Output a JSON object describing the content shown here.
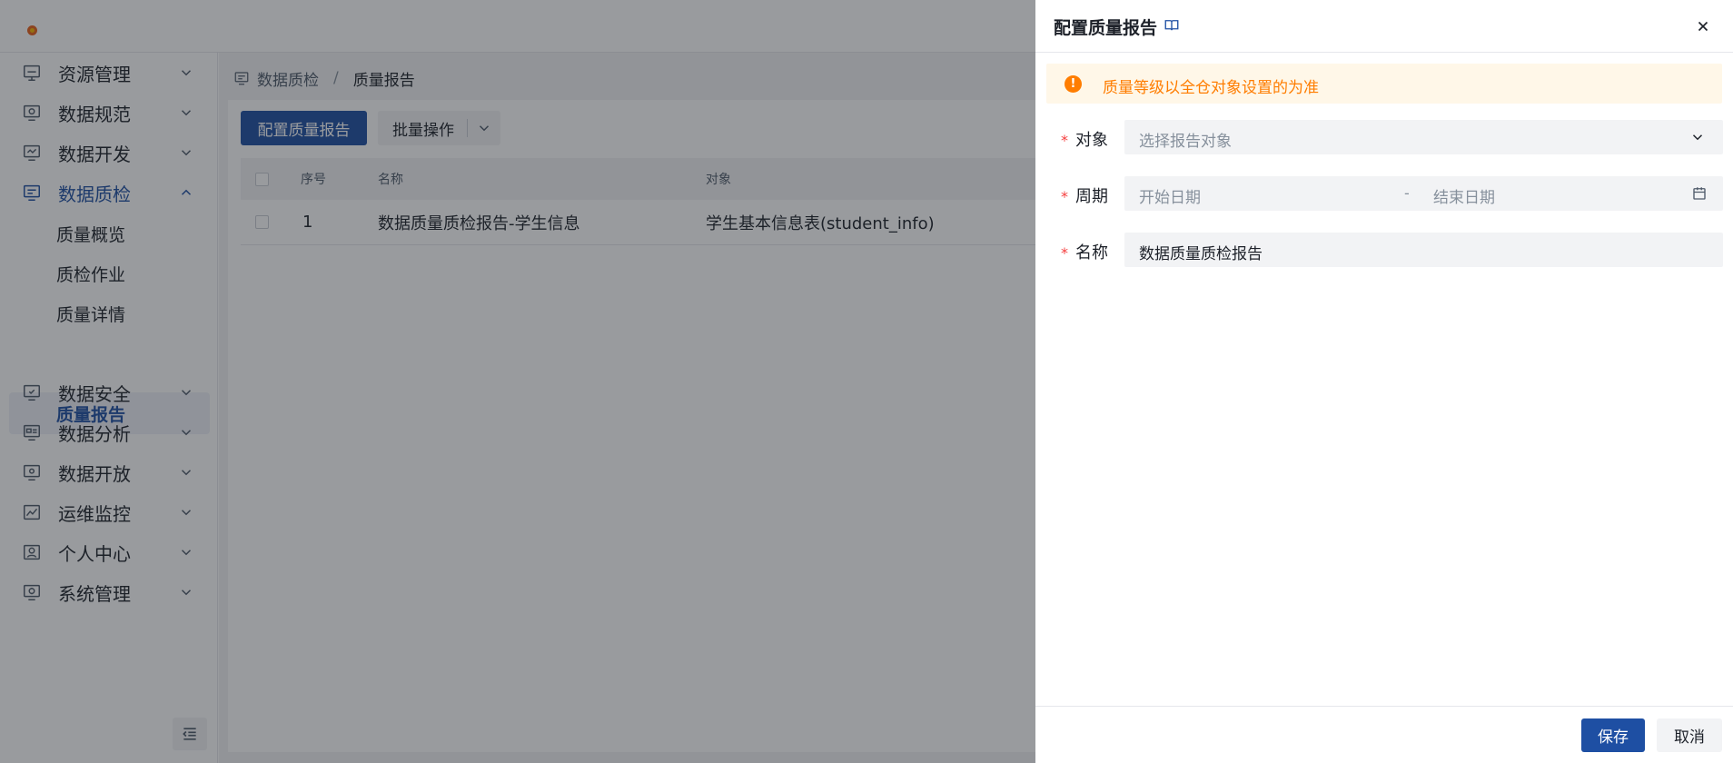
{
  "sidebar": {
    "items": [
      {
        "label": "资源管理",
        "icon": "monitor-icon"
      },
      {
        "label": "数据规范",
        "icon": "monitor-icon"
      },
      {
        "label": "数据开发",
        "icon": "monitor-icon"
      },
      {
        "label": "数据质检",
        "icon": "monitor-icon"
      },
      {
        "label": "数据安全",
        "icon": "monitor-icon"
      },
      {
        "label": "数据分析",
        "icon": "monitor-icon"
      },
      {
        "label": "数据开放",
        "icon": "monitor-icon"
      },
      {
        "label": "运维监控",
        "icon": "chart-icon"
      },
      {
        "label": "个人中心",
        "icon": "user-icon"
      },
      {
        "label": "系统管理",
        "icon": "monitor-icon"
      }
    ],
    "subitems": [
      {
        "label": "质量概览"
      },
      {
        "label": "质检作业"
      },
      {
        "label": "质量详情"
      },
      {
        "label": "质量报告"
      }
    ]
  },
  "breadcrumb": {
    "parent": "数据质检",
    "separator": "/",
    "current": "质量报告"
  },
  "toolbar": {
    "primary_label": "配置质量报告",
    "batch_label": "批量操作"
  },
  "table": {
    "headers": {
      "index": "序号",
      "name": "名称",
      "object": "对象"
    },
    "rows": [
      {
        "index": "1",
        "name": "数据质量质检报告-学生信息",
        "object": "学生基本信息表(student_info)"
      }
    ]
  },
  "drawer": {
    "title": "配置质量报告",
    "alert": "质量等级以全仓对象设置的为准",
    "alert_icon": "!",
    "required_mark": "*",
    "fields": {
      "object_label": "对象",
      "object_placeholder": "选择报告对象",
      "period_label": "周期",
      "period_start_placeholder": "开始日期",
      "period_sep": "-",
      "period_end_placeholder": "结束日期",
      "name_label": "名称",
      "name_value": "数据质量质检报告"
    },
    "save_label": "保存",
    "cancel_label": "取消"
  },
  "colors": {
    "primary": "#1e4fa3",
    "warning": "#ff7d00",
    "warning_bg": "#fff7e8",
    "required": "#f53f3f"
  }
}
